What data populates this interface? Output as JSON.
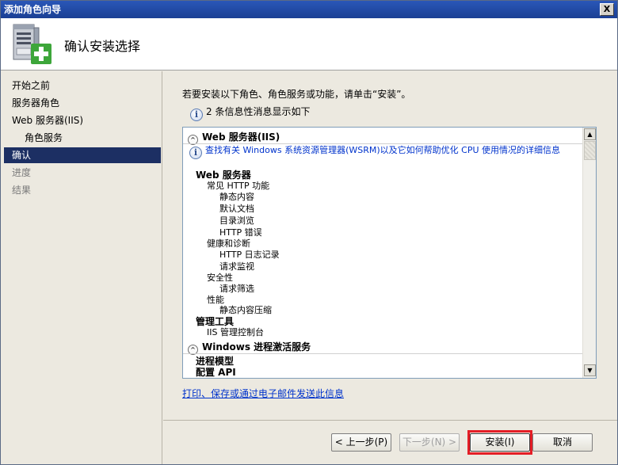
{
  "window": {
    "title": "添加角色向导",
    "close_glyph": "X"
  },
  "header": {
    "title": "确认安装选择",
    "icon": "server-add-icon"
  },
  "nav": {
    "items": [
      {
        "label": "开始之前",
        "state": "normal"
      },
      {
        "label": "服务器角色",
        "state": "normal"
      },
      {
        "label": "Web 服务器(IIS)",
        "state": "normal"
      },
      {
        "label": "角色服务",
        "state": "normal"
      },
      {
        "label": "确认",
        "state": "active"
      },
      {
        "label": "进度",
        "state": "disabled"
      },
      {
        "label": "结果",
        "state": "disabled"
      }
    ]
  },
  "content": {
    "instruction": "若要安装以下角色、角色服务或功能，请单击“安装”。",
    "info_icon_glyph": "i",
    "info_message": "2 条信息性消息显示如下",
    "sections": [
      {
        "title": "Web 服务器(IIS)",
        "info_link": "查找有关 Windows 系统资源管理器(WSRM)以及它如何帮助优化 CPU 使用情况的详细信息",
        "items": [
          {
            "label": "Web 服务器",
            "bold": true
          },
          {
            "label": "常见 HTTP 功能"
          },
          {
            "label": "静态内容"
          },
          {
            "label": "默认文档"
          },
          {
            "label": "目录浏览"
          },
          {
            "label": "HTTP 错误"
          },
          {
            "label": "健康和诊断"
          },
          {
            "label": "HTTP 日志记录"
          },
          {
            "label": "请求监视"
          },
          {
            "label": "安全性"
          },
          {
            "label": "请求筛选"
          },
          {
            "label": "性能"
          },
          {
            "label": "静态内容压缩"
          },
          {
            "label": "管理工具",
            "bold": true
          },
          {
            "label": "IIS 管理控制台"
          }
        ]
      },
      {
        "title": "Windows 进程激活服务",
        "items": [
          {
            "label": "进程模型",
            "bold": true
          },
          {
            "label": "配置 API",
            "bold": true
          }
        ]
      }
    ],
    "collapse_glyph": "^",
    "scroll_up_glyph": "▲",
    "scroll_down_glyph": "▼",
    "bottom_link": "打印、保存或通过电子邮件发送此信息"
  },
  "footer": {
    "prev_label": "< 上一步(P)",
    "next_label": "下一步(N) >",
    "install_label": "安装(I)",
    "cancel_label": "取消",
    "highlight_color": "#e41e26"
  }
}
